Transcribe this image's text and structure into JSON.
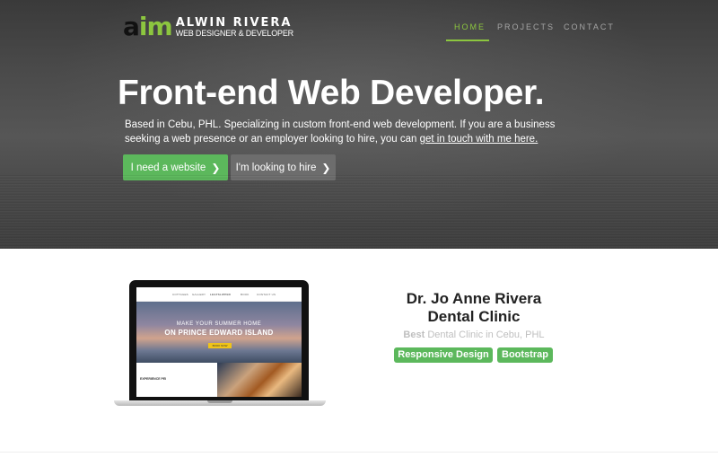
{
  "brand": {
    "mark_a": "a",
    "mark_i": "i",
    "mark_m": "m",
    "name": "ALWIN RIVERA",
    "tagline": "WEB DESIGNER & DEVELOPER",
    "accent_color": "#8cc63f"
  },
  "nav": {
    "items": [
      {
        "label": "HOME",
        "active": true
      },
      {
        "label": "PROJECTS",
        "active": false
      },
      {
        "label": "CONTACT",
        "active": false
      }
    ]
  },
  "hero": {
    "title": "Front-end Web Developer.",
    "intro": "Based in Cebu, PHL. Specializing in custom front-end web development. If you are a business seeking a web presence or an employer looking to hire, you can ",
    "intro_link": "get in touch with me here.",
    "buttons": {
      "primary": "I need a website",
      "secondary": "I'm looking to hire"
    },
    "chevron_icon": "chevron-right-icon"
  },
  "project": {
    "title_line1": "Dr. Jo Anne Rivera",
    "title_line2": "Dental Clinic",
    "subtitle_bold": "Best",
    "subtitle_rest": " Dental Clinic in Cebu, PHL",
    "tags": [
      "Responsive Design",
      "Bootstrap"
    ],
    "tag_color": "#5cb85c",
    "preview": {
      "logo": "LEGTSLIPPER",
      "nav": [
        "COTTAGES",
        "GALLERY",
        "BOOK",
        "CONTACT US"
      ],
      "headline_small": "MAKE YOUR SUMMER HOME",
      "headline_big": "ON PRINCE EDWARD ISLAND",
      "cta": "BOOK NOW",
      "section": "EXPERIENCE PEI"
    }
  }
}
